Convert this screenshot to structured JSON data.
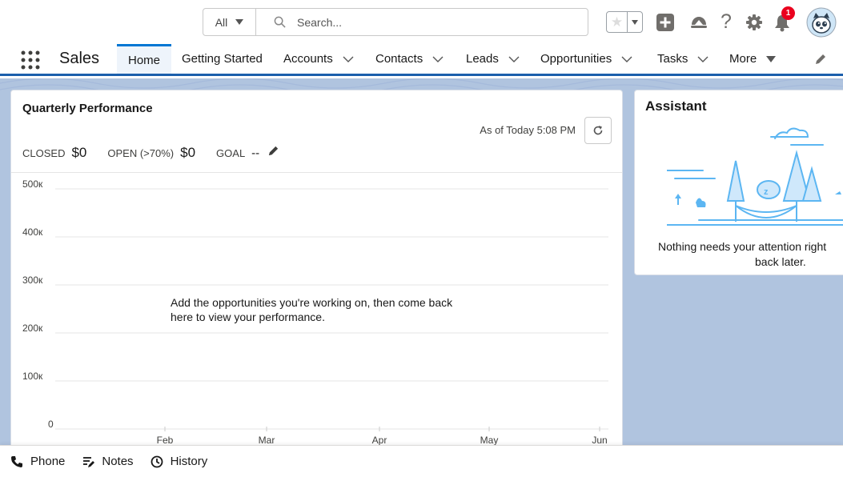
{
  "header": {
    "search_scope": "All",
    "search_placeholder": "Search...",
    "notification_count": "1"
  },
  "nav": {
    "app_name": "Sales",
    "tabs": [
      {
        "label": "Home",
        "selected": true
      },
      {
        "label": "Getting Started"
      },
      {
        "label": "Accounts"
      },
      {
        "label": "Contacts"
      },
      {
        "label": "Leads"
      },
      {
        "label": "Opportunities"
      },
      {
        "label": "Tasks"
      },
      {
        "label": "More"
      }
    ]
  },
  "performance": {
    "title": "Quarterly Performance",
    "as_of": "As of Today 5:08 PM",
    "closed_label": "CLOSED",
    "closed_value": "$0",
    "open_label": "OPEN (>70%)",
    "open_value": "$0",
    "goal_label": "GOAL",
    "goal_value": "--",
    "empty_message_line1": "Add the opportunities you're working on, then come back",
    "empty_message_line2": "here to view your performance."
  },
  "chart_data": {
    "type": "line",
    "categories": [
      "Feb",
      "Mar",
      "Apr",
      "May",
      "Jun"
    ],
    "y_ticks": [
      "0",
      "100к",
      "200к",
      "300к",
      "400к",
      "500к"
    ],
    "ylim": [
      0,
      500000
    ],
    "series": []
  },
  "assistant": {
    "title": "Assistant",
    "message_line1": "Nothing needs your attention right",
    "message_line2": "back later."
  },
  "utility_bar": {
    "items": [
      "Phone",
      "Notes",
      "History"
    ]
  },
  "colors": {
    "brand_blue": "#0176d3",
    "nav_underline": "#1b5fac",
    "page_background": "#b0c4df",
    "notification_red": "#ea001e",
    "illustration_blue": "#5cb6f2"
  }
}
